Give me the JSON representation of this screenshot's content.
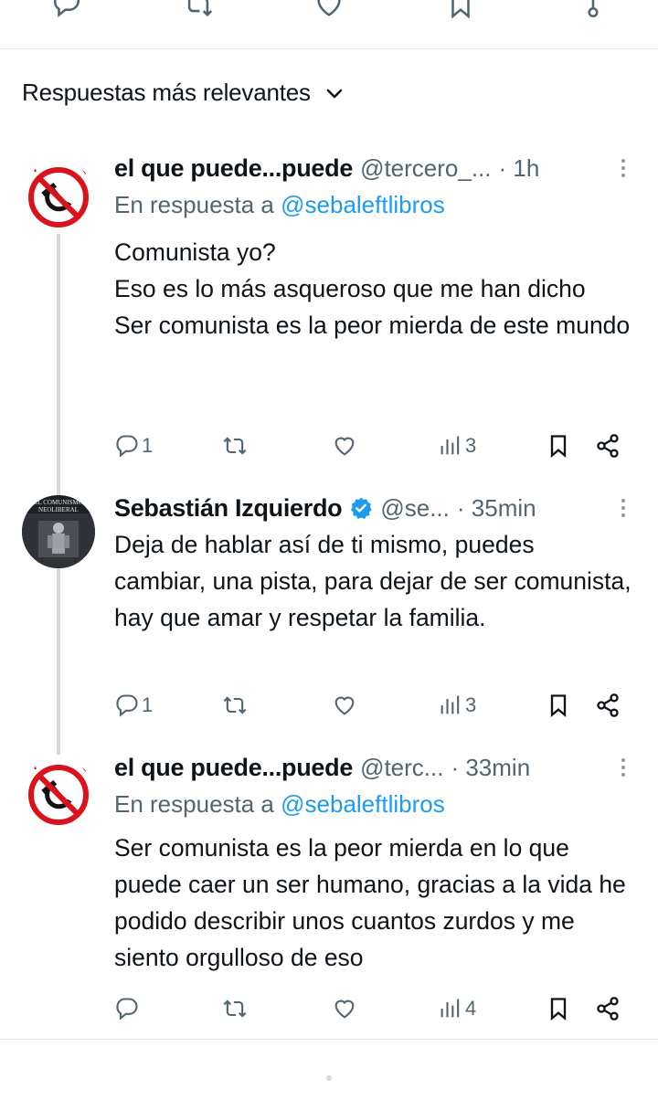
{
  "top_bar": {
    "icons": [
      "reply-icon",
      "repost-icon",
      "like-icon",
      "bookmark-icon",
      "share-icon"
    ]
  },
  "sort": {
    "label": "Respuestas más relevantes",
    "icon": "chevron-down-icon"
  },
  "tweets": [
    {
      "name": "el que puede...puede",
      "handle": "@tercero_...",
      "time": "· 1h",
      "reply_prefix": "En respuesta a ",
      "reply_to": "@sebaleftlibros",
      "text": "Comunista yo?\nEso es lo más asqueroso que me han dicho\nSer comunista es la peor mierda de este mundo",
      "replies": "1",
      "reposts": "",
      "likes": "",
      "views": "3",
      "avatar": "anti-communism-symbol"
    },
    {
      "name": "Sebastián Izquierdo",
      "verified": true,
      "handle": "@se...",
      "time": "· 35min",
      "text": "Deja de hablar así de ti mismo, puedes cambiar, una pista, para dejar de ser comunista, hay que amar y respetar la familia.",
      "replies": "1",
      "reposts": "",
      "likes": "",
      "views": "3",
      "avatar": "book-cover-photo",
      "avatar_text_1": "EL COMUNISMO",
      "avatar_text_2": "NEOLIBERAL"
    },
    {
      "name": "el que puede...puede",
      "handle": "@terc...",
      "time": "· 33min",
      "reply_prefix": "En respuesta a ",
      "reply_to": "@sebaleftlibros",
      "text": "Ser comunista es la peor mierda en lo que puede caer un ser humano, gracias a la vida he podido describir unos cuantos zurdos y me siento orgulloso de eso",
      "replies": "",
      "reposts": "",
      "likes": "",
      "views": "4",
      "avatar": "anti-communism-symbol"
    }
  ],
  "colors": {
    "text": "#0f1419",
    "secondary": "#536471",
    "link": "#1d9bf0",
    "divider": "#e6e8ea",
    "thread_line": "#cfd9de",
    "prohibition_red": "#d9121b"
  }
}
